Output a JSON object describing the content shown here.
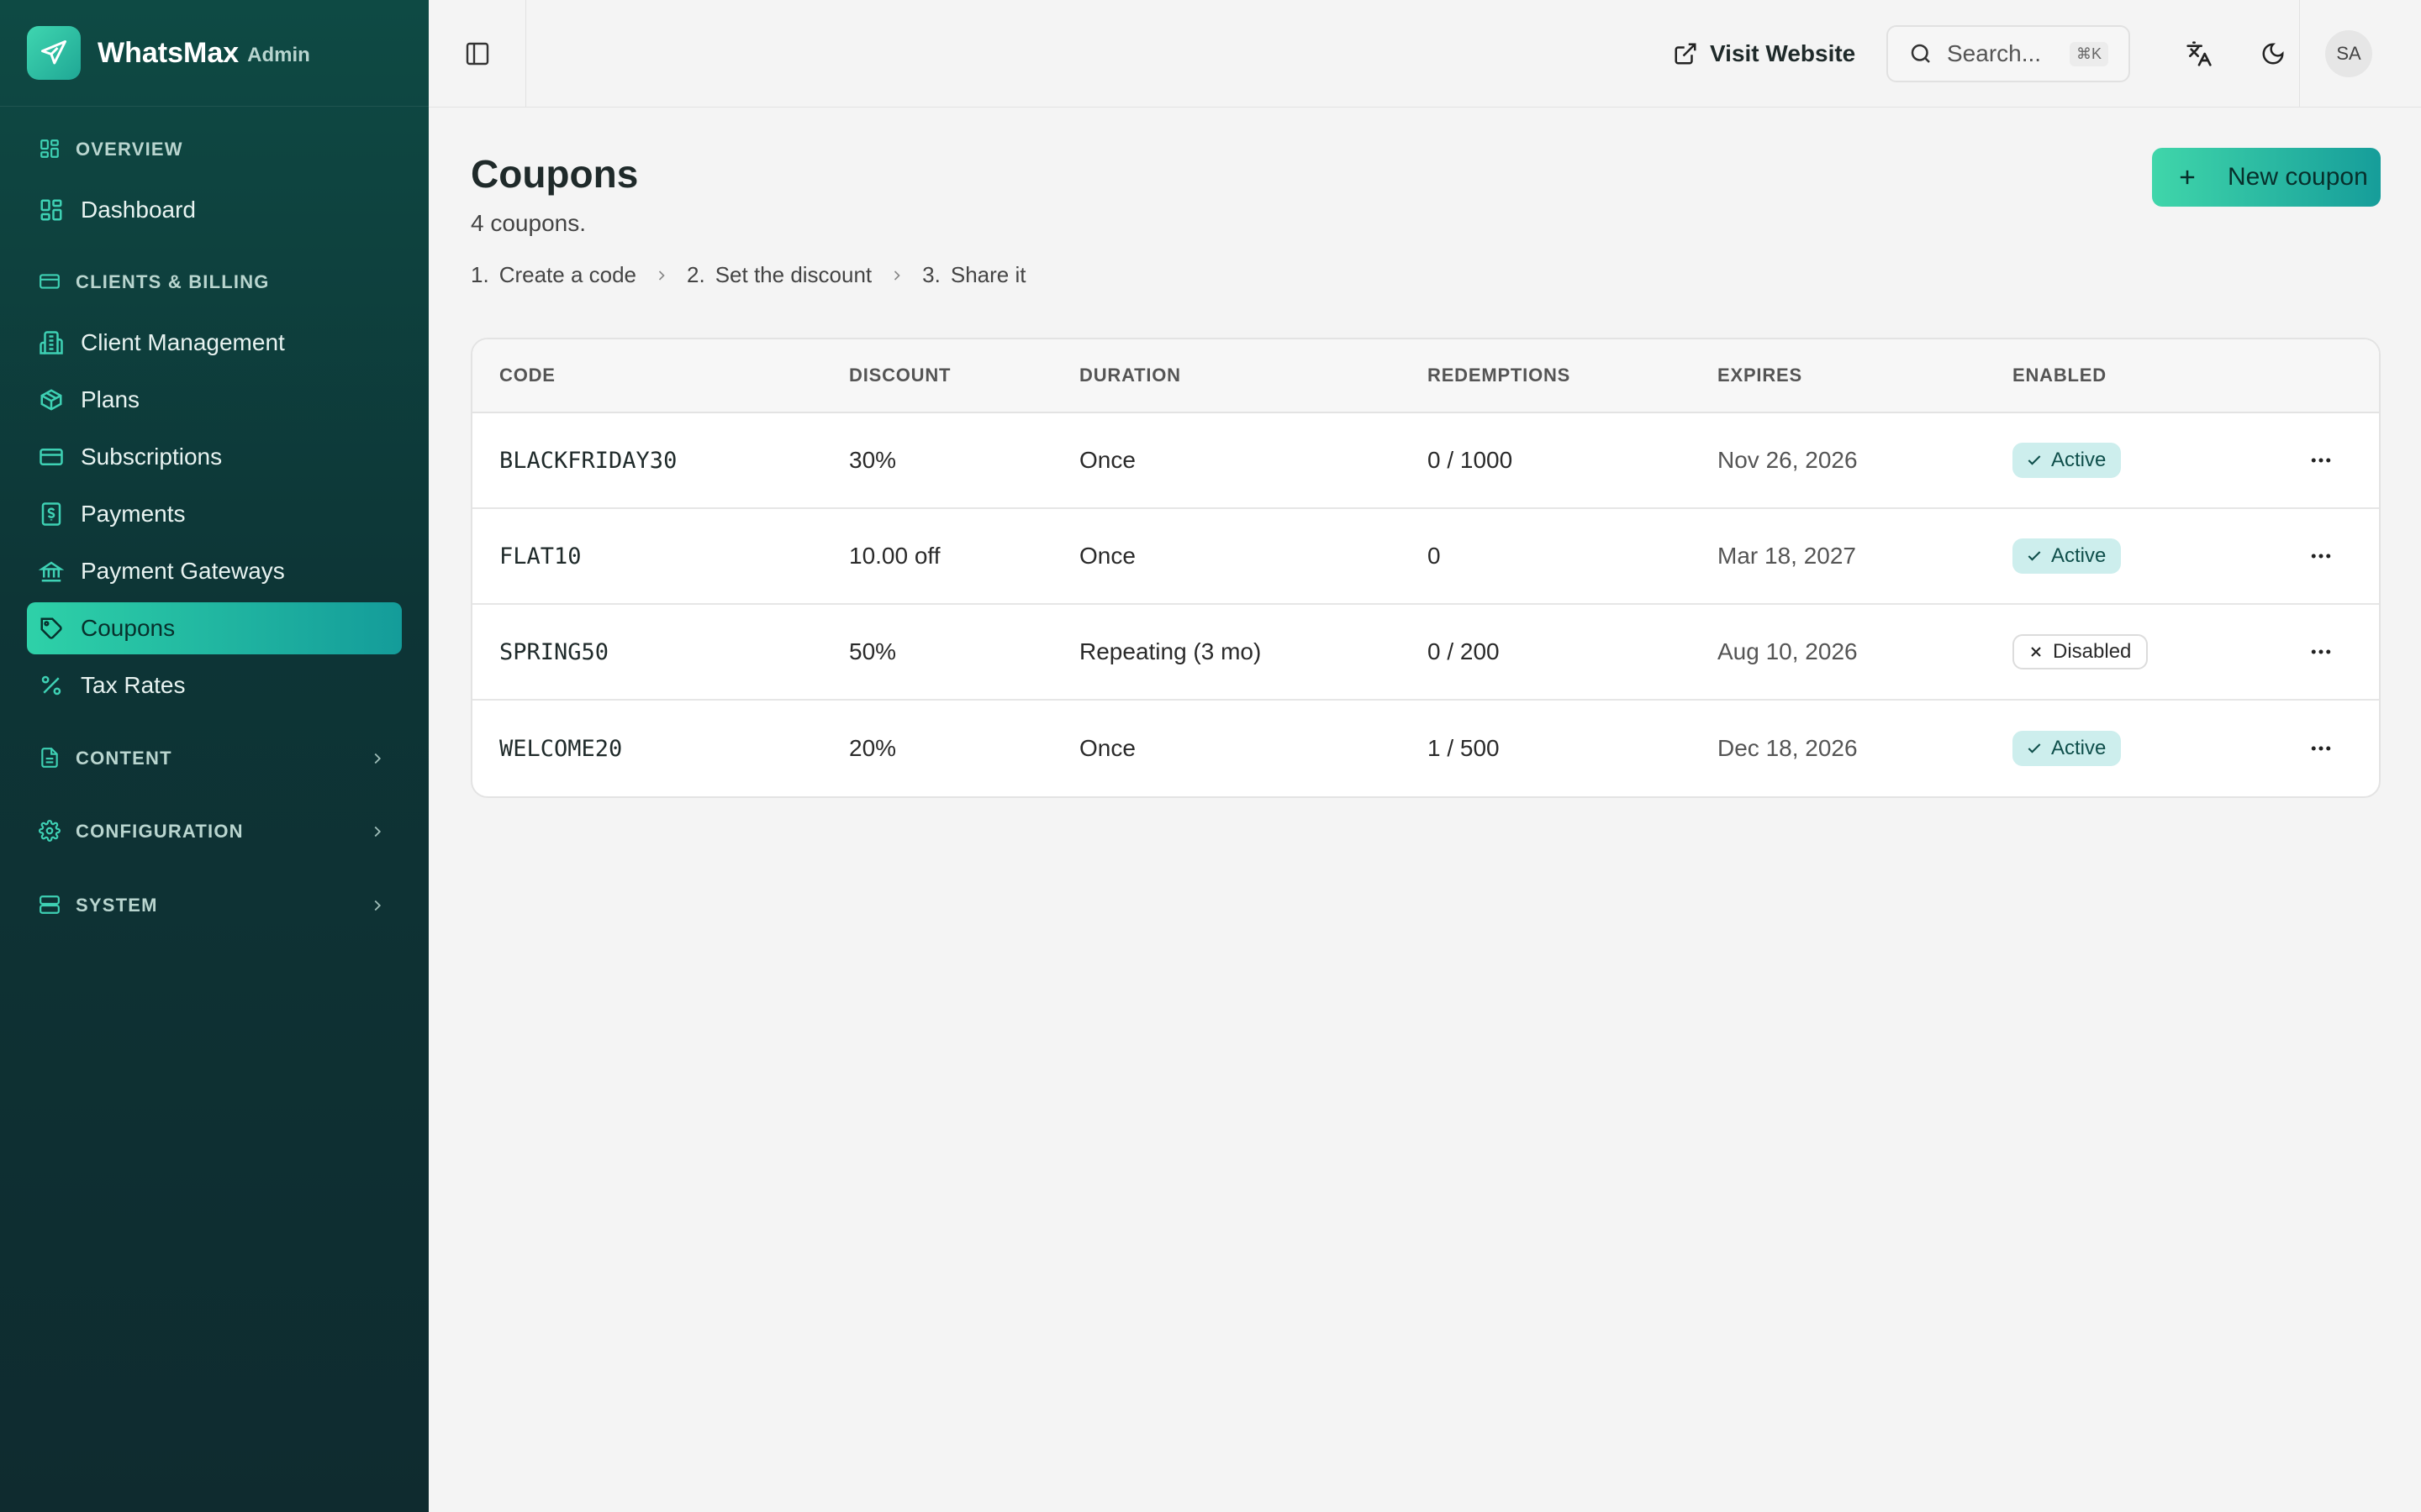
{
  "brand": {
    "name": "WhatsMax",
    "sub": "Admin"
  },
  "sidebar": {
    "overview": {
      "label": "OVERVIEW",
      "items": [
        {
          "label": "Dashboard"
        }
      ]
    },
    "clients_billing": {
      "label": "CLIENTS & BILLING",
      "items": [
        {
          "label": "Client Management"
        },
        {
          "label": "Plans"
        },
        {
          "label": "Subscriptions"
        },
        {
          "label": "Payments"
        },
        {
          "label": "Payment Gateways"
        },
        {
          "label": "Coupons"
        },
        {
          "label": "Tax Rates"
        }
      ]
    },
    "content": {
      "label": "CONTENT"
    },
    "configuration": {
      "label": "CONFIGURATION"
    },
    "system": {
      "label": "SYSTEM"
    },
    "active_item": "Coupons"
  },
  "topbar": {
    "visit_label": "Visit Website",
    "search": {
      "placeholder": "Search...",
      "shortcut": "⌘K"
    },
    "avatar_initials": "SA"
  },
  "page": {
    "title": "Coupons",
    "subtitle": "4 coupons.",
    "steps": [
      {
        "num": "1.",
        "label": "Create a code"
      },
      {
        "num": "2.",
        "label": "Set the discount"
      },
      {
        "num": "3.",
        "label": "Share it"
      }
    ],
    "new_button": "New coupon"
  },
  "table": {
    "columns": [
      "CODE",
      "DISCOUNT",
      "DURATION",
      "REDEMPTIONS",
      "EXPIRES",
      "ENABLED"
    ],
    "rows": [
      {
        "code": "BLACKFRIDAY30",
        "discount": "30%",
        "duration": "Once",
        "redemptions": "0 / 1000",
        "expires": "Nov 26, 2026",
        "status": "Active"
      },
      {
        "code": "FLAT10",
        "discount": "10.00 off",
        "duration": "Once",
        "redemptions": "0",
        "expires": "Mar 18, 2027",
        "status": "Active"
      },
      {
        "code": "SPRING50",
        "discount": "50%",
        "duration": "Repeating (3 mo)",
        "redemptions": "0 / 200",
        "expires": "Aug 10, 2026",
        "status": "Disabled"
      },
      {
        "code": "WELCOME20",
        "discount": "20%",
        "duration": "Once",
        "redemptions": "1 / 500",
        "expires": "Dec 18, 2026",
        "status": "Active"
      }
    ]
  },
  "colors": {
    "accent": "#2ed1a8",
    "accent_dark": "#149c9a",
    "sidebar_bg": "#0d3536",
    "active_badge_bg": "#cdeeed"
  }
}
